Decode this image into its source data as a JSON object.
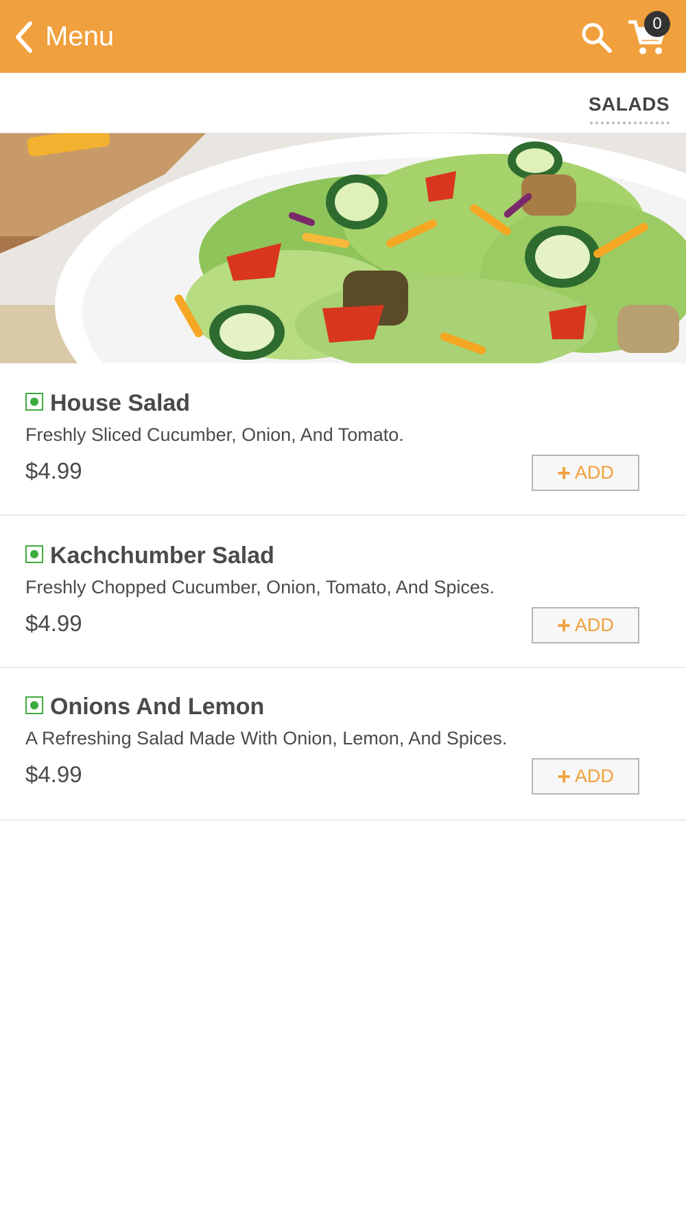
{
  "header": {
    "back_icon": "chevron-left-icon",
    "title": "Menu",
    "search_icon": "search-icon",
    "cart_icon": "cart-icon",
    "cart_count": "0",
    "background": "#F0A03C"
  },
  "tabs": {
    "active": "SALADS"
  },
  "hero": {
    "image": "salad-photo"
  },
  "items": [
    {
      "name": "House Salad",
      "description": "Freshly Sliced Cucumber, Onion, And Tomato.",
      "price": "$4.99",
      "add_plus": "+",
      "add_label": "ADD",
      "veg": true
    },
    {
      "name": "Kachchumber Salad",
      "description": "Freshly Chopped Cucumber, Onion, Tomato, And Spices.",
      "price": "$4.99",
      "add_plus": "+",
      "add_label": "ADD",
      "veg": true
    },
    {
      "name": "Onions And Lemon",
      "description": "A Refreshing Salad Made With Onion, Lemon, And Spices.",
      "price": "$4.99",
      "add_plus": "+",
      "add_label": "ADD",
      "veg": true
    }
  ],
  "colors": {
    "accent": "#F0A03C",
    "veg_green": "#3dab3d",
    "text": "#4a4a4a"
  }
}
